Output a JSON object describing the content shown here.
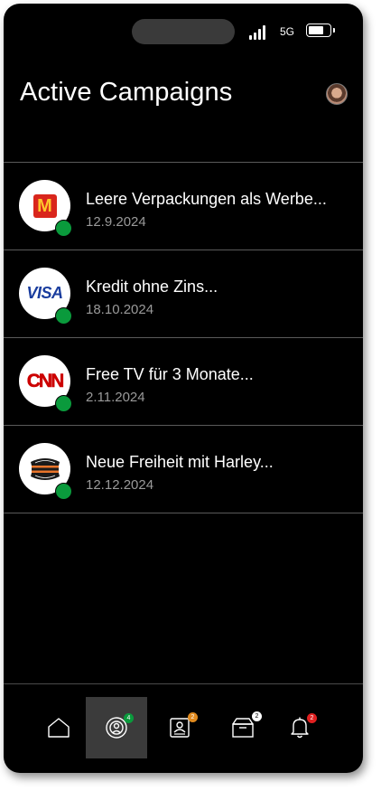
{
  "status_bar": {
    "network": "5G",
    "battery_level": 0.78
  },
  "header": {
    "title": "Active Campaigns"
  },
  "campaigns": [
    {
      "title": "Leere Verpackungen als Werbe...",
      "date": "12.9.2024",
      "logo": "mcdonalds-logo",
      "status": "active"
    },
    {
      "title": "Kredit ohne Zins...",
      "date": "18.10.2024",
      "logo": "visa-logo",
      "status": "active"
    },
    {
      "title": "Free TV für 3 Monate...",
      "date": "2.11.2024",
      "logo": "cnn-logo",
      "status": "active"
    },
    {
      "title": "Neue Freiheit mit Harley...",
      "date": "12.12.2024",
      "logo": "harley-davidson-logo",
      "status": "active"
    }
  ],
  "logos": {
    "visa_text": "VISA",
    "cnn_text": "CNN",
    "mcd_text": "M"
  },
  "nav": {
    "items": [
      {
        "icon": "home-icon",
        "badge": ""
      },
      {
        "icon": "broadcast-icon",
        "badge": "4",
        "active": true
      },
      {
        "icon": "contact-card-icon",
        "badge": "2"
      },
      {
        "icon": "inbox-box-icon",
        "badge": "2"
      },
      {
        "icon": "bell-icon",
        "badge": "2"
      }
    ]
  },
  "colors": {
    "active_dot": "#0a9a3c",
    "badge_green": "#0a9a3c",
    "badge_orange": "#e08a1e",
    "badge_white": "#ffffff",
    "badge_red": "#e02020"
  }
}
